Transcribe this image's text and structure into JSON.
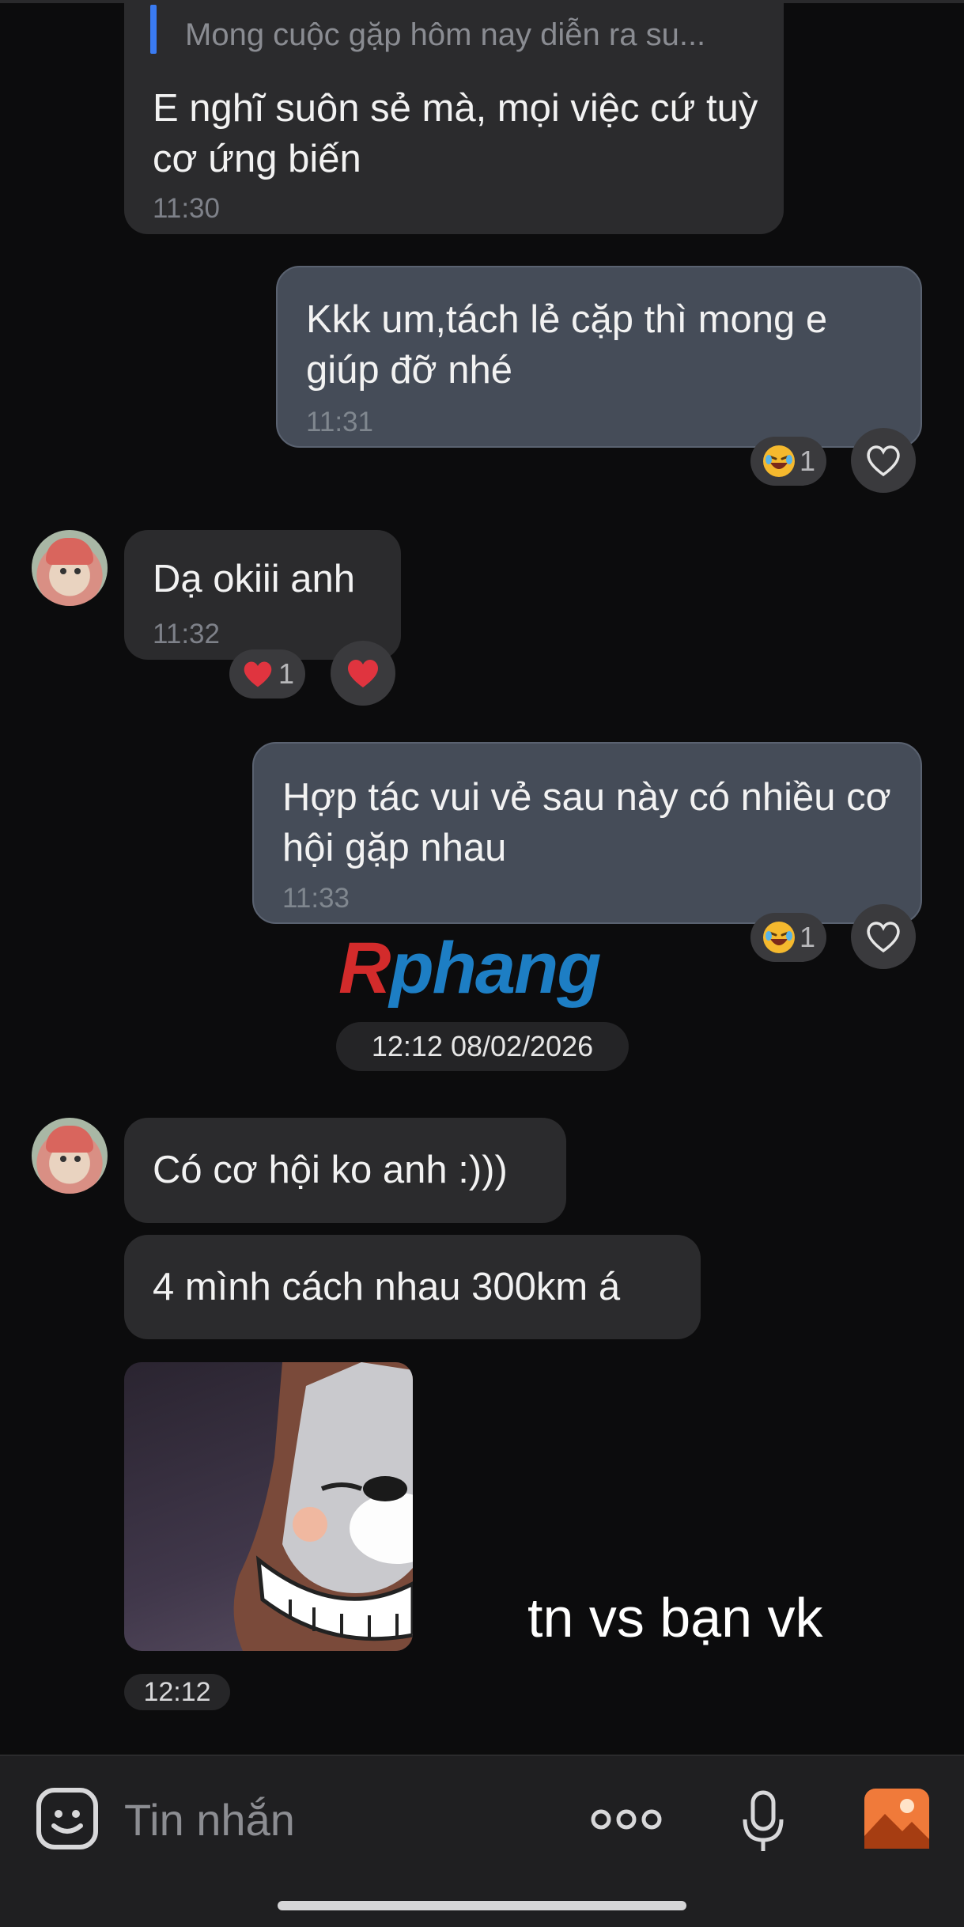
{
  "messages": {
    "m1": {
      "quote": "Mong cuộc gặp hôm nay diễn ra su...",
      "text": "E nghĩ suôn sẻ mà, mọi việc cứ tuỳ cơ ứng biến",
      "time": "11:30"
    },
    "m2": {
      "text": "Kkk um,tách lẻ cặp thì mong e giúp đỡ nhé",
      "time": "11:31",
      "reaction_count": "1",
      "reaction_icon": "laughing-emoji"
    },
    "m3": {
      "text": "Dạ okiii anh",
      "time": "11:32",
      "reaction_count": "1",
      "reaction_icon": "red-heart-emoji"
    },
    "m4": {
      "text": "Hợp tác vui vẻ sau này có nhiều cơ hội gặp nhau",
      "time": "11:33",
      "reaction_count": "1",
      "reaction_icon": "laughing-emoji"
    },
    "m5": {
      "text": "Có cơ hội ko anh :)))"
    },
    "m6": {
      "text": "4 mình cách nhau 300km á"
    },
    "m7": {
      "time": "12:12",
      "sticker": "grinning-dog-sticker"
    }
  },
  "date_separator": "12:12 08/02/2026",
  "watermark": {
    "first": "R",
    "rest": "phang"
  },
  "caption": "tn vs bạn vk",
  "input": {
    "placeholder": "Tin nhắn"
  },
  "colors": {
    "outgoing": "#454c58",
    "incoming": "#2b2b2d",
    "accent": "#3a7bf2",
    "heart": "#e0343f",
    "photo": "#f07a3a"
  }
}
